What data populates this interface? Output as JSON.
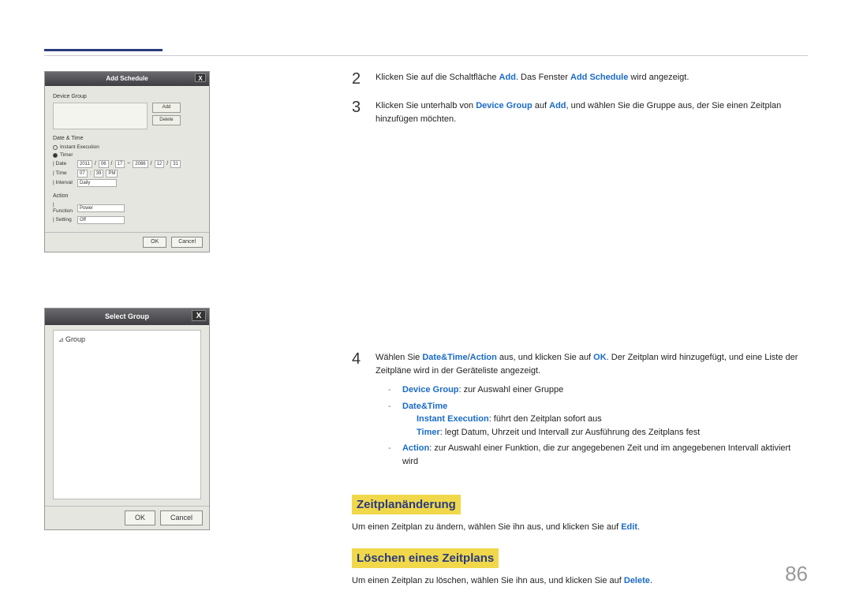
{
  "pageNumber": "86",
  "addScheduleDialog": {
    "title": "Add Schedule",
    "close": "X",
    "deviceGroupLabel": "Device Group",
    "addBtn": "Add",
    "deleteBtn": "Delete",
    "dateTimeLabel": "Date & Time",
    "instantExecLabel": "Instant Execution",
    "timerLabel": "Timer",
    "dateLabel": "Date",
    "date_y1": "2011",
    "date_m1": "06",
    "date_d1": "17",
    "tilde": "~",
    "date_y2": "2086",
    "date_m2": "12",
    "date_d2": "31",
    "timeLabel": "Time",
    "time_h": "07",
    "time_m": "39",
    "time_ap": "PM",
    "intervalLabel": "Interval",
    "intervalVal": "Daily",
    "actionLabel": "Action",
    "functionLabel": "Function",
    "functionVal": "Power",
    "settingLabel": "Setting",
    "settingVal": "Off",
    "ok": "OK",
    "cancel": "Cancel"
  },
  "selectGroupDialog": {
    "title": "Select Group",
    "close": "X",
    "rootNode": "Group",
    "ok": "OK",
    "cancel": "Cancel"
  },
  "steps": {
    "s2": {
      "num": "2",
      "t1": "Klicken Sie auf die Schaltfläche ",
      "b1": "Add",
      "t2": ". Das Fenster ",
      "b2": "Add Schedule",
      "t3": " wird angezeigt."
    },
    "s3": {
      "num": "3",
      "t1": "Klicken Sie unterhalb von ",
      "b1": "Device Group",
      "t2": " auf ",
      "b2": "Add",
      "t3": ", und wählen Sie die Gruppe aus, der Sie einen Zeitplan hinzufügen möchten."
    },
    "s4": {
      "num": "4",
      "t1": "Wählen Sie ",
      "b1": "Date&Time",
      "slash": "/",
      "b2": "Action",
      "t2": " aus, und klicken Sie auf ",
      "b3": "OK",
      "t3": ". Der Zeitplan wird hinzugefügt, und eine Liste der Zeitpläne wird in der Geräteliste angezeigt.",
      "sub": {
        "a_b": "Device Group",
        "a_t": ": zur Auswahl einer Gruppe",
        "b_b": "Date&Time",
        "b1_b": "Instant Execution",
        "b1_t": ": führt den Zeitplan sofort aus",
        "b2_b": "Timer",
        "b2_t": ": legt Datum, Uhrzeit und Intervall zur Ausführung des Zeitplans fest",
        "c_b": "Action",
        "c_t": ": zur Auswahl einer Funktion, die zur angegebenen Zeit und im angegebenen Intervall aktiviert wird"
      }
    }
  },
  "sections": {
    "changeHeading": "Zeitplanänderung",
    "change_t1": "Um einen Zeitplan zu ändern, wählen Sie ihn aus, und klicken Sie auf ",
    "change_b": "Edit",
    "change_t2": ".",
    "deleteHeading": "Löschen eines Zeitplans",
    "delete_t1": "Um einen Zeitplan zu löschen, wählen Sie ihn aus, und klicken Sie auf ",
    "delete_b": "Delete",
    "delete_t2": "."
  }
}
